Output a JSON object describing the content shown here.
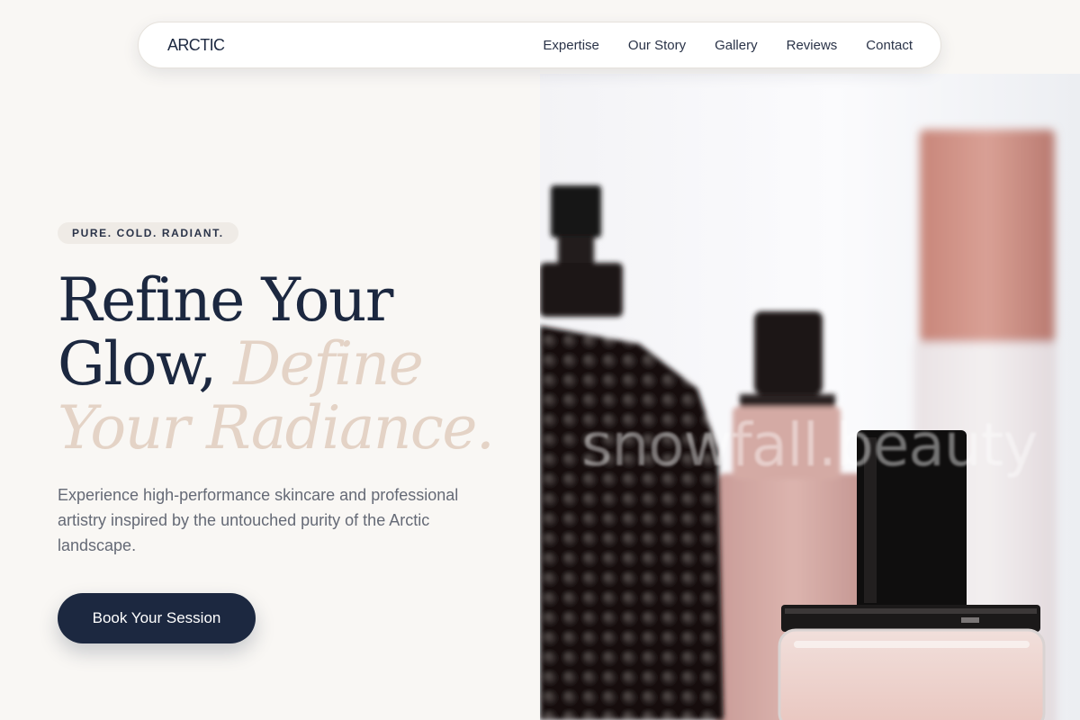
{
  "nav": {
    "logo": "ARCTIC",
    "links": [
      "Expertise",
      "Our Story",
      "Gallery",
      "Reviews",
      "Contact"
    ]
  },
  "hero": {
    "badge": "PURE. COLD. RADIANT.",
    "headline_line1": "Refine Your",
    "headline_line2_plain": "Glow, ",
    "headline_line2_accent": "Define",
    "headline_line3_accent": "Your Radiance.",
    "description": "Experience high-performance skincare and professional artistry inspired by the untouched purity of the Arctic landscape.",
    "cta_label": "Book Your Session"
  },
  "image": {
    "watermark": "snowfall.beauty"
  },
  "colors": {
    "navy": "#1c2840",
    "accent_blush": "#e4d3c6",
    "background": "#f9f7f4",
    "text_muted": "#656a76"
  }
}
